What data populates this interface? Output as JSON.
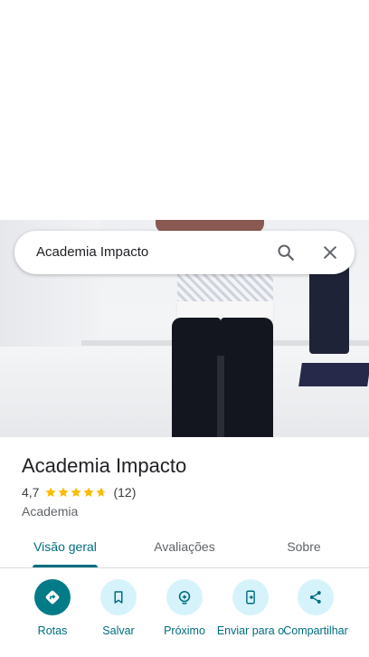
{
  "search": {
    "query": "Academia Impacto"
  },
  "place": {
    "title": "Academia Impacto",
    "rating": "4,7",
    "rating_value": 4.7,
    "rating_max": 5,
    "reviews_count": "(12)",
    "category": "Academia"
  },
  "tabs": [
    {
      "label": "Visão geral",
      "active": true
    },
    {
      "label": "Avaliações",
      "active": false
    },
    {
      "label": "Sobre",
      "active": false
    }
  ],
  "actions": [
    {
      "label": "Rotas",
      "icon": "directions-icon"
    },
    {
      "label": "Salvar",
      "icon": "bookmark-icon"
    },
    {
      "label": "Próximo",
      "icon": "nearby-icon"
    },
    {
      "label": "Enviar para o",
      "icon": "send-to-phone-icon"
    },
    {
      "label": "Compartilhar",
      "icon": "share-icon"
    }
  ],
  "colors": {
    "accent": "#006d80",
    "primary_button": "#007b87",
    "secondary_button_bg": "#d6f3fb",
    "star": "#fbbc04"
  }
}
